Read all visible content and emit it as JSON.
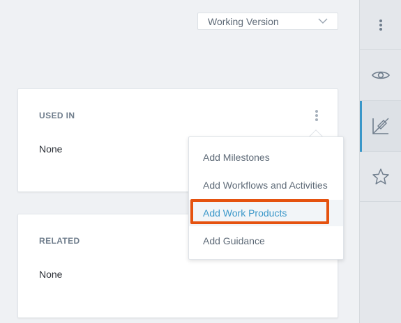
{
  "header": {
    "version_select": {
      "value": "Working Version"
    }
  },
  "cards": {
    "used_in": {
      "title": "USED IN",
      "value": "None"
    },
    "related": {
      "title": "RELATED",
      "value": "None"
    }
  },
  "menu": {
    "items": [
      {
        "label": "Add Milestones"
      },
      {
        "label": "Add Workflows and Activities"
      },
      {
        "label": "Add Work Products"
      },
      {
        "label": "Add Guidance"
      }
    ],
    "highlighted_item": "Add Work Products"
  },
  "sidebar": {
    "items": [
      {
        "icon": "kebab-vertical-icon"
      },
      {
        "icon": "eye-icon"
      },
      {
        "icon": "chart-edit-icon",
        "active": true
      },
      {
        "icon": "star-icon"
      }
    ]
  },
  "colors": {
    "accent": "#3a97c9",
    "highlight_outline": "#e5520f",
    "background": "#eff1f4",
    "sidebar": "#e4e7eb"
  }
}
